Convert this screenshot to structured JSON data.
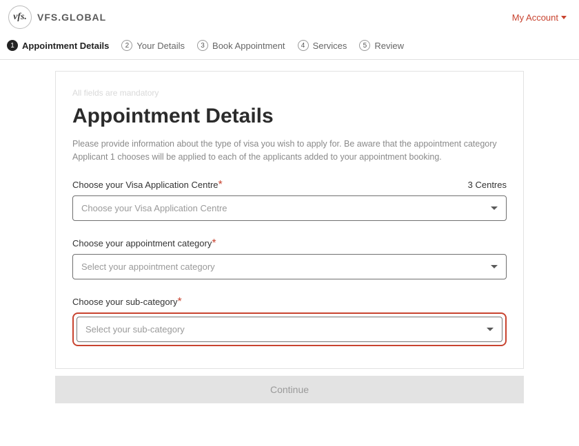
{
  "brand": {
    "logo_text": "vfs.",
    "name": "VFS.GLOBAL"
  },
  "account": {
    "label": "My Account"
  },
  "steps": [
    {
      "num": "1",
      "label": "Appointment Details",
      "active": true
    },
    {
      "num": "2",
      "label": "Your Details",
      "active": false
    },
    {
      "num": "3",
      "label": "Book Appointment",
      "active": false
    },
    {
      "num": "4",
      "label": "Services",
      "active": false
    },
    {
      "num": "5",
      "label": "Review",
      "active": false
    }
  ],
  "form": {
    "mandatory_note": "All fields are mandatory",
    "title": "Appointment Details",
    "description": "Please provide information about the type of visa you wish to apply for. Be aware that the appointment category Applicant 1 chooses will be applied to each of the applicants added to your appointment booking.",
    "centre": {
      "label": "Choose your Visa Application Centre",
      "required": "*",
      "meta": "3 Centres",
      "placeholder": "Choose your Visa Application Centre"
    },
    "category": {
      "label": "Choose your appointment category",
      "required": "*",
      "placeholder": "Select your appointment category"
    },
    "subcategory": {
      "label": "Choose your sub-category",
      "required": "*",
      "placeholder": "Select your sub-category"
    },
    "continue": "Continue"
  }
}
